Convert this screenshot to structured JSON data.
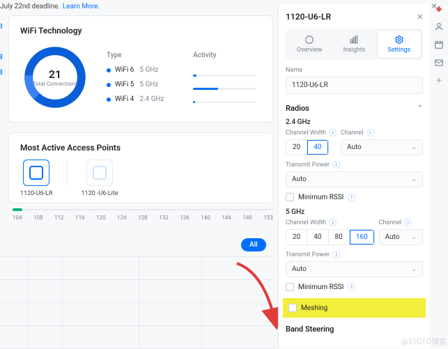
{
  "topbar": {
    "deadline_text": "July 22nd deadline.",
    "learn_more": "Learn More."
  },
  "wifi_card": {
    "title": "WiFi Technology",
    "type_label": "Type",
    "activity_label": "Activity",
    "donut": {
      "value": "21",
      "label": "Total Connections"
    },
    "rows": [
      {
        "name": "WiFi 6",
        "ghz": "5 GHz",
        "activity_pct": 6
      },
      {
        "name": "WiFi 5",
        "ghz": "5 GHz",
        "activity_pct": 40
      },
      {
        "name": "WiFi 4",
        "ghz": "2.4 GHz",
        "activity_pct": 3
      }
    ]
  },
  "ap_card": {
    "title": "Most Active Access Points",
    "items": [
      {
        "name": "1120-U6-LR",
        "selected": true
      },
      {
        "name": "1120 -U6-Lite",
        "selected": false
      }
    ]
  },
  "axis_ticks": [
    "104",
    "108",
    "112",
    "116",
    "120",
    "124",
    "128",
    "132",
    "136",
    "140",
    "144",
    "149",
    "153"
  ],
  "all_label": "All",
  "panel": {
    "title": "1120-U6-LR",
    "tabs": {
      "overview": "Overview",
      "insights": "Insights",
      "settings": "Settings",
      "active": "settings"
    },
    "name_label": "Name",
    "name_value": "1120-U6-LR",
    "radios_label": "Radios",
    "radio_24": {
      "title": "2.4 GHz",
      "channel_width_label": "Channel Width",
      "widths": [
        "20",
        "40"
      ],
      "width_selected": "40",
      "channel_label": "Channel",
      "channel_value": "Auto",
      "tx_label": "Transmit Power",
      "tx_value": "Auto",
      "min_rssi": "Minimum RSSI"
    },
    "radio_5": {
      "title": "5 GHz",
      "channel_width_label": "Channel Width",
      "widths": [
        "20",
        "40",
        "80",
        "160"
      ],
      "width_selected": "160",
      "channel_label": "Channel",
      "channel_value": "Auto",
      "tx_label": "Transmit Power",
      "tx_value": "Auto",
      "min_rssi": "Minimum RSSI"
    },
    "meshing_label": "Meshing",
    "band_steering_label": "Band Steering"
  },
  "watermark": "@51CTO博客"
}
